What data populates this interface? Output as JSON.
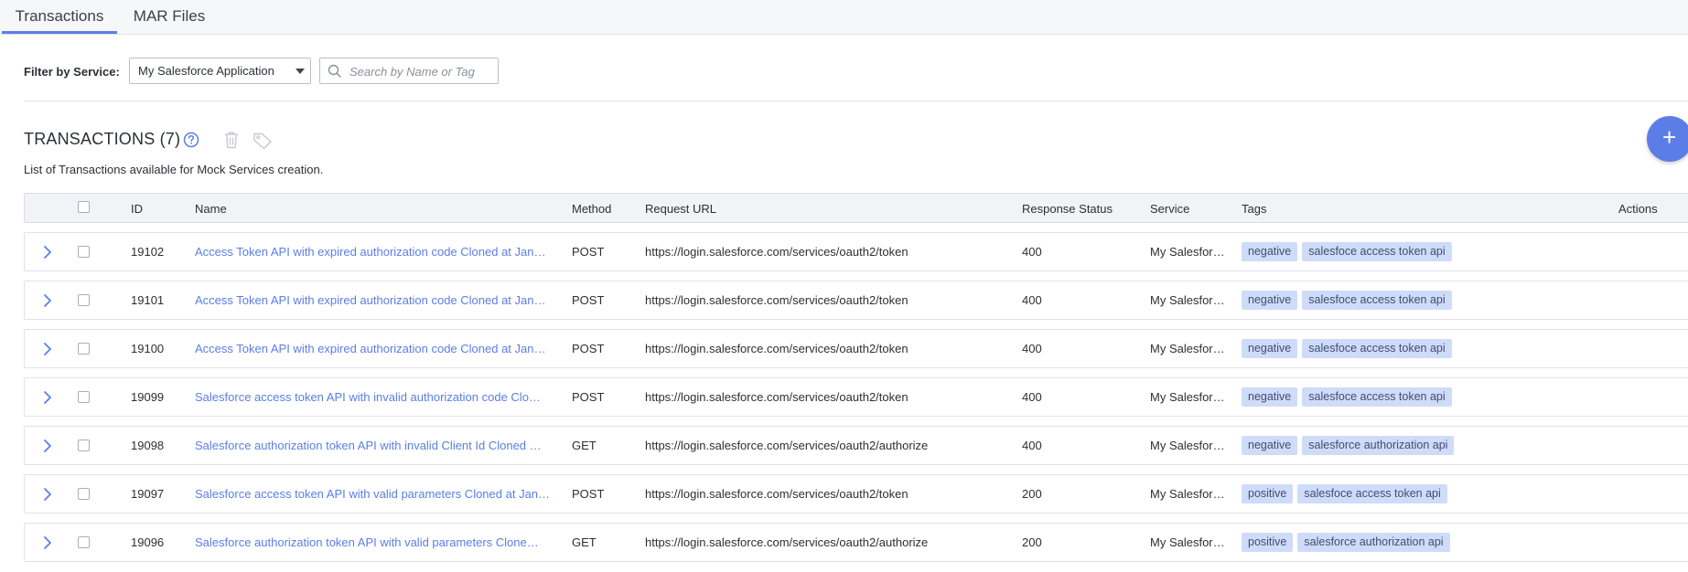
{
  "tabs": [
    {
      "label": "Transactions",
      "active": true
    },
    {
      "label": "MAR Files",
      "active": false
    }
  ],
  "filter": {
    "label": "Filter by Service:",
    "selected": "My Salesforce Application",
    "search_placeholder": "Search by Name or Tag",
    "search_value": ""
  },
  "section": {
    "title": "TRANSACTIONS (7)",
    "subtitle": "List of Transactions available for Mock Services creation.",
    "help_icon": "question-circle-icon",
    "delete_icon": "trash-icon",
    "tag_icon": "tag-icon",
    "add_icon": "plus-icon"
  },
  "colors": {
    "accent": "#5b7ee6",
    "tag_bg": "#cfdcf9",
    "tag_text": "#3f4f72",
    "header_bg": "#f1f3f6"
  },
  "table": {
    "columns": [
      "ID",
      "Name",
      "Method",
      "Request URL",
      "Response Status",
      "Service",
      "Tags",
      "Actions"
    ],
    "rows": [
      {
        "id": "19102",
        "name": "Access Token API with expired authorization code Cloned at Jan…",
        "method": "POST",
        "url": "https://login.salesforce.com/services/oauth2/token",
        "status": "400",
        "service": "My Salesfor…",
        "tags": [
          "negative",
          "salesfoce access token api"
        ]
      },
      {
        "id": "19101",
        "name": "Access Token API with expired authorization code Cloned at Jan…",
        "method": "POST",
        "url": "https://login.salesforce.com/services/oauth2/token",
        "status": "400",
        "service": "My Salesfor…",
        "tags": [
          "negative",
          "salesfoce access token api"
        ]
      },
      {
        "id": "19100",
        "name": "Access Token API with expired authorization code Cloned at Jan…",
        "method": "POST",
        "url": "https://login.salesforce.com/services/oauth2/token",
        "status": "400",
        "service": "My Salesfor…",
        "tags": [
          "negative",
          "salesfoce access token api"
        ]
      },
      {
        "id": "19099",
        "name": "Salesforce access token API with invalid authorization code Clo…",
        "method": "POST",
        "url": "https://login.salesforce.com/services/oauth2/token",
        "status": "400",
        "service": "My Salesfor…",
        "tags": [
          "negative",
          "salesfoce access token api"
        ]
      },
      {
        "id": "19098",
        "name": "Salesforce authorization token API with invalid Client Id Cloned …",
        "method": "GET",
        "url": "https://login.salesforce.com/services/oauth2/authorize",
        "status": "400",
        "service": "My Salesfor…",
        "tags": [
          "negative",
          "salesforce authorization api"
        ]
      },
      {
        "id": "19097",
        "name": "Salesforce access token API with valid parameters Cloned at Jan…",
        "method": "POST",
        "url": "https://login.salesforce.com/services/oauth2/token",
        "status": "200",
        "service": "My Salesfor…",
        "tags": [
          "positive",
          "salesfoce access token api"
        ]
      },
      {
        "id": "19096",
        "name": "Salesforce authorization token API with valid parameters Clone…",
        "method": "GET",
        "url": "https://login.salesforce.com/services/oauth2/authorize",
        "status": "200",
        "service": "My Salesfor…",
        "tags": [
          "positive",
          "salesforce authorization api"
        ]
      }
    ]
  }
}
